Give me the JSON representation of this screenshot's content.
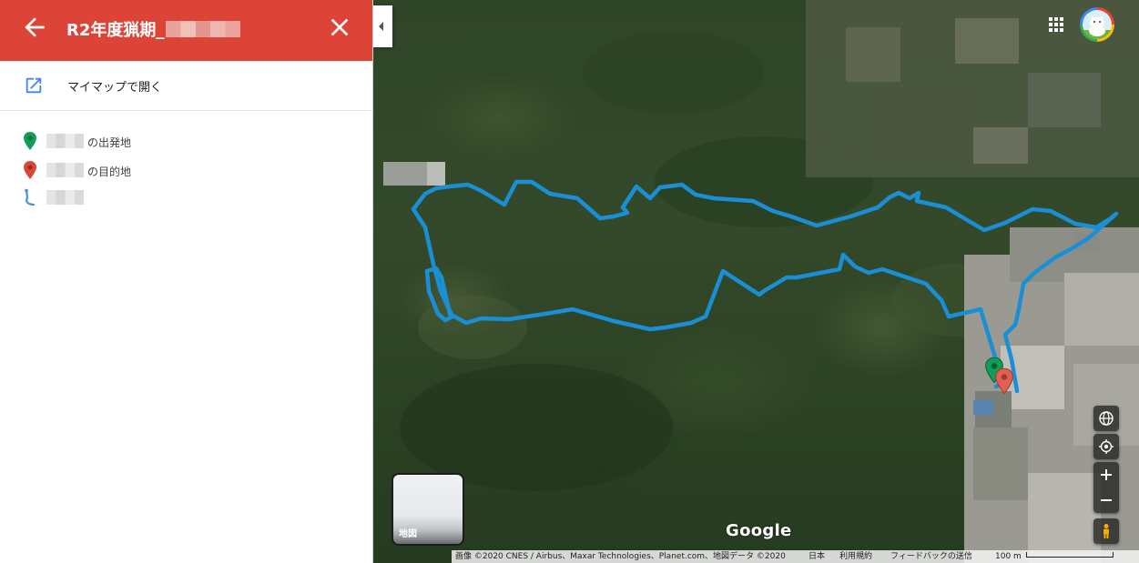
{
  "panel": {
    "title": "R2年度猟期_",
    "header_color": "#db4437",
    "back_icon": "arrow-back-icon",
    "close_icon": "close-icon",
    "open_link": {
      "label": "マイマップで開く",
      "icon": "open-in-new-icon",
      "icon_color": "#4285f4"
    },
    "legend": [
      {
        "label": "の出発地",
        "icon": "green-pin-icon",
        "color": "#0f9d58"
      },
      {
        "label": "の目的地",
        "icon": "red-pin-icon",
        "color": "#db4437"
      },
      {
        "label": "",
        "icon": "route-icon",
        "color": "#4a90d9"
      }
    ]
  },
  "map": {
    "route_color": "#1a8fd6",
    "layer_toggle_label": "地図",
    "logo": "Google",
    "attribution": {
      "imagery": "画像 ©2020 CNES / Airbus、Maxar Technologies、Planet.com、地図データ ©2020",
      "region": "日本",
      "terms": "利用規約",
      "feedback": "フィードバックの送信",
      "scale": "100 m"
    },
    "controls": [
      "globe-icon",
      "my-location-icon",
      "zoom-in-icon",
      "zoom-out-icon",
      "pegman-icon"
    ]
  }
}
